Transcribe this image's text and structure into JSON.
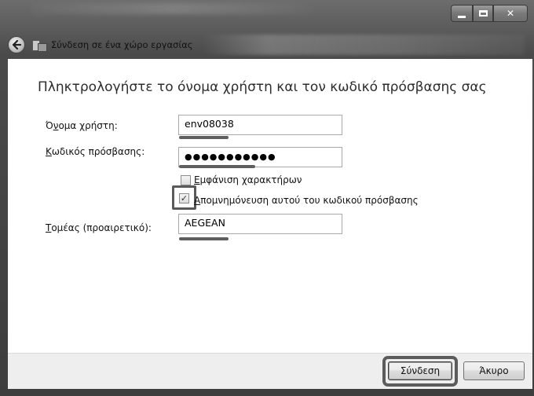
{
  "window": {
    "title": "Σύνδεση σε ένα χώρο εργασίας"
  },
  "icons": {
    "back": "back-arrow-icon",
    "app": "network-workplace-icon",
    "minimize": "minimize-icon",
    "maximize": "maximize-icon",
    "close": "close-icon"
  },
  "main": {
    "heading": "Πληκτρολογήστε το όνομα χρήστη και τον κωδικό πρόσβασης σας",
    "username": {
      "label_prefix": "Ό",
      "label_access": "ν",
      "label_rest": "ομα χρήστη:",
      "value": "env08038"
    },
    "password": {
      "label_access": "Κ",
      "label_rest": "ωδικός πρόσβασης:",
      "value": "●●●●●●●●●●●"
    },
    "show_chars": {
      "label_access": "Ε",
      "label_rest": "μφάνιση χαρακτήρων",
      "checked": false
    },
    "remember": {
      "label_access": "Α",
      "label_rest": "πομνημόνευση αυτού του κωδικού πρόσβασης",
      "checked": true
    },
    "domain": {
      "label_access": "Τ",
      "label_rest": "ομέας (προαιρετικό):",
      "value": "AEGEAN"
    }
  },
  "footer": {
    "connect_label": "Σύνδεση",
    "cancel_label": "Άκυρο"
  },
  "colors": {
    "annotation": "#5a5a5a"
  }
}
